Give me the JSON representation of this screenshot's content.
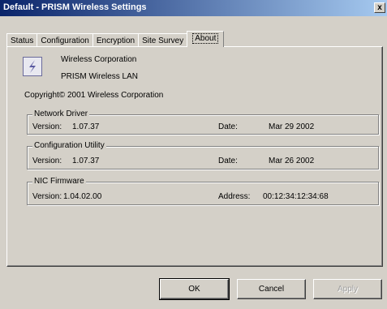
{
  "window": {
    "title": "Default - PRISM Wireless Settings",
    "close_glyph": "x"
  },
  "tabs": [
    {
      "label": "Status"
    },
    {
      "label": "Configuration"
    },
    {
      "label": "Encryption"
    },
    {
      "label": "Site Survey"
    },
    {
      "label": "About",
      "active": true
    }
  ],
  "about": {
    "icon": "wireless-logo-icon",
    "company": "Wireless Corporation",
    "product": "PRISM Wireless LAN",
    "copyright": "Copyright© 2001  Wireless Corporation",
    "network_driver": {
      "legend": "Network Driver",
      "version_label": "Version:",
      "version_value": "1.07.37",
      "date_label": "Date:",
      "date_value": "Mar 29 2002"
    },
    "config_utility": {
      "legend": "Configuration Utility",
      "version_label": "Version:",
      "version_value": "1.07.37",
      "date_label": "Date:",
      "date_value": "Mar 26 2002"
    },
    "nic_firmware": {
      "legend": "NIC Firmware",
      "version_label": "Version:",
      "version_value": "1.04.02.00",
      "address_label": "Address:",
      "address_value": "00:12:34:12:34:68"
    }
  },
  "buttons": {
    "ok": "OK",
    "cancel": "Cancel",
    "apply": "Apply"
  }
}
